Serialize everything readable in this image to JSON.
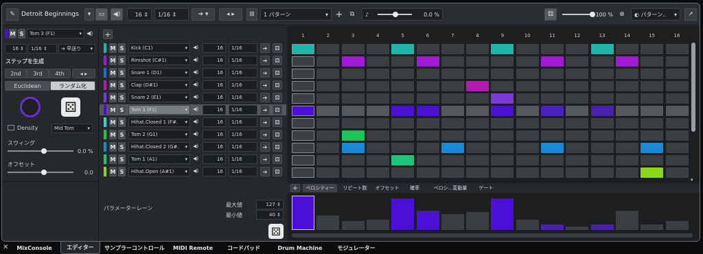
{
  "topbar": {
    "pattern_name": "Detroit Beginnings",
    "steps": "16",
    "resolution": "1/16",
    "pattern_select": "1 パターン",
    "swing_value": "0.0 %",
    "vel_value": "100 %",
    "preset": "パターン.."
  },
  "left": {
    "instrument": "Tom 3 (F1)",
    "steps": "16",
    "res": "1/16",
    "direction": "早送り",
    "gen_label": "ステップを生成",
    "gen_btns": [
      "2nd",
      "3rd",
      "4th"
    ],
    "euclid": "Euclidean",
    "random": "ランダム化",
    "density": "Density",
    "mid_tom": "Mid Tom",
    "swing_label": "スウィング",
    "swing_value": "0.0 %",
    "offset_label": "オフセット",
    "offset_value": "0.0"
  },
  "tracks": [
    {
      "name": "Kick (C1)",
      "color": "#1fb5a8",
      "steps": "16",
      "res": "1/16"
    },
    {
      "name": "Rimshot (C#1)",
      "color": "#a21ad6",
      "steps": "16",
      "res": "1/16"
    },
    {
      "name": "Snare 1 (D1)",
      "color": "#2a6ad6",
      "steps": "16",
      "res": "1/16"
    },
    {
      "name": "Clap (D#1)",
      "color": "#b21ab2",
      "steps": "16",
      "res": "1/16"
    },
    {
      "name": "Snare 2 (E1)",
      "color": "#7a3ad6",
      "steps": "16",
      "res": "1/16"
    },
    {
      "name": "Tom 3 (F1)",
      "color": "#4a10d6",
      "steps": "16",
      "res": "1/16"
    },
    {
      "name": "Hihat.Closed 1 (F#.",
      "color": "#2ad6d6",
      "steps": "16",
      "res": "1/16"
    },
    {
      "name": "Tom 2 (G1)",
      "color": "#1ac65a",
      "steps": "16",
      "res": "1/16"
    },
    {
      "name": "Hihat.Closed 2 (G#.",
      "color": "#1a8ad6",
      "steps": "16",
      "res": "1/16"
    },
    {
      "name": "Tom 1 (A1)",
      "color": "#1ac67a",
      "steps": "16",
      "res": "1/16"
    },
    {
      "name": "Hihat.Open (A#1)",
      "color": "#8ad61a",
      "steps": "16",
      "res": "1/16"
    }
  ],
  "param_lane": {
    "label": "パラメーターレーン",
    "max_label": "最大値",
    "max_value": "127",
    "min_label": "最小値",
    "min_value": "40"
  },
  "grid": {
    "columns": [
      "1",
      "2",
      "3",
      "4",
      "5",
      "6",
      "7",
      "8",
      "9",
      "10",
      "11",
      "12",
      "13",
      "14",
      "15",
      "16"
    ]
  },
  "lane_tabs": [
    "ベロシティー",
    "リピート数",
    "オフセット",
    "確率",
    "ベロシ...変動量",
    "ゲート"
  ],
  "bottom_tabs": [
    "MixConsole",
    "エディター",
    "サンプラーコントロール",
    "MIDI Remote",
    "コードパッド",
    "Drum Machine",
    "モジュレーター"
  ],
  "velocity": [
    127,
    70,
    55,
    60,
    120,
    85,
    75,
    80,
    120,
    60,
    45,
    40,
    45,
    85,
    45,
    55
  ]
}
